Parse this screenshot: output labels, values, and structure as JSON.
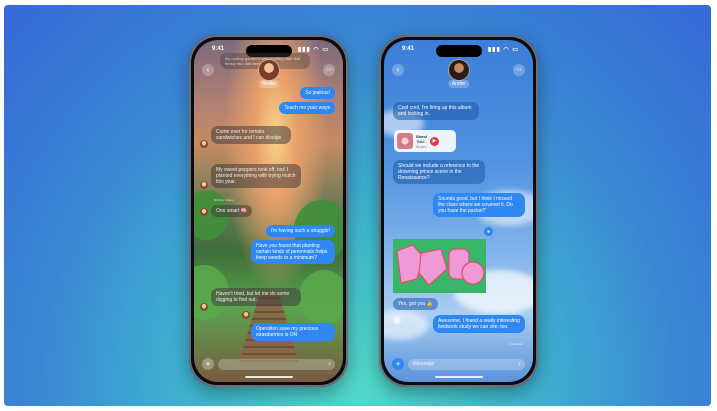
{
  "left_phone": {
    "time": "9:41",
    "status_icons": "▮▮▮ ◠ ▭",
    "contact_name": "Bodie",
    "header_snippet": "My rooftop garden's very exciting after that heavy rain last week",
    "messages": [
      {
        "dir": "out",
        "text": "So jealous!"
      },
      {
        "dir": "out",
        "text": "Teach me your ways"
      },
      {
        "dir": "in",
        "text": "Come over for tomato sandwiches and I can divulge"
      },
      {
        "dir": "in",
        "text": "My sweet peppers took off, too! I planted everything with trying mulch this year."
      },
      {
        "dir": "in",
        "text": "Ooo smart 🧠"
      },
      {
        "dir": "out",
        "text": "I'm having such a struggle!"
      },
      {
        "dir": "out",
        "text": "Have you found that planting certain kinds of perennials helps keep weeds to a minimum?"
      },
      {
        "dir": "in",
        "text": "Haven't tried, but let me do some digging to find out."
      },
      {
        "dir": "out",
        "text": "Operation save my precious strawberries is ON"
      }
    ],
    "small_label": "Nichole Chang",
    "composer_placeholder": ""
  },
  "right_phone": {
    "time": "9:41",
    "status_icons": "▮▮▮ ◠ ▭",
    "contact_name": "Andre",
    "messages": [
      {
        "dir": "in",
        "text": "Cool cool, I'm firing up this album and locking in."
      },
      {
        "dir": "in",
        "text": "Should we include a reference to the drowning prince scene in the Renaissance?"
      },
      {
        "dir": "out",
        "text": "Sounds good, but I think I missed the class where we covered it. Do you have the packet?"
      },
      {
        "dir": "in",
        "text": "Yes, got you 👍"
      },
      {
        "dir": "out",
        "text": "Awesome, I found a really interesting fieldwork study we can cite, too."
      }
    ],
    "album": {
      "title": "Sheol",
      "artist": "Tiala",
      "source": "Music"
    },
    "delivered_label": "Delivered",
    "composer_placeholder": "iMessage"
  },
  "colors": {
    "bubble_out": "#2f87f2",
    "background_top": "#3568d8",
    "background_bottom": "#52d9c9"
  }
}
